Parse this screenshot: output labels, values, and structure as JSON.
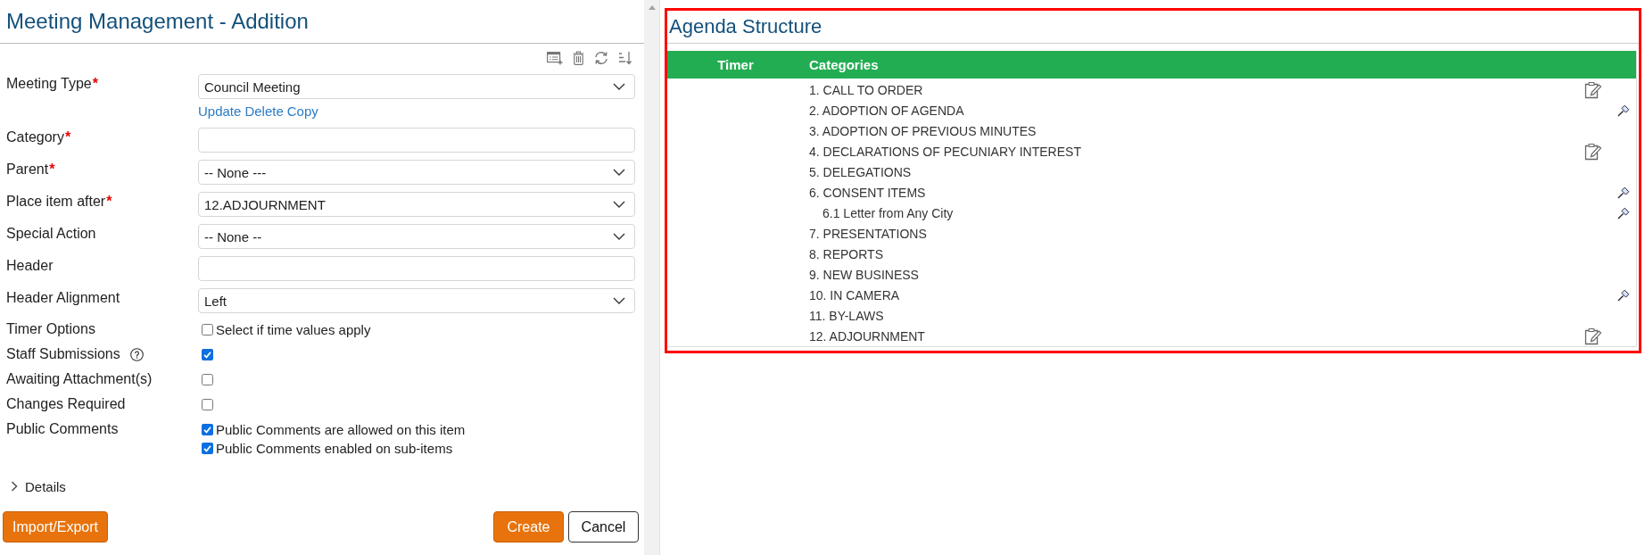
{
  "form": {
    "title": "Meeting Management - Addition",
    "fields": [
      {
        "kind": "select",
        "label": "Meeting Type",
        "required_mark": "*",
        "value": "Council Meeting",
        "links": [
          "Update",
          "Delete",
          "Copy"
        ]
      },
      {
        "kind": "text",
        "label": "Category",
        "required_mark": "*"
      },
      {
        "kind": "select",
        "label": "Parent",
        "required_mark": "*",
        "value": "-- None ---"
      },
      {
        "kind": "select",
        "label": "Place item after",
        "required_mark": "*",
        "value": "12.ADJOURNMENT"
      },
      {
        "kind": "select",
        "label": "Special Action",
        "value": "-- None --"
      },
      {
        "kind": "text",
        "label": "Header"
      },
      {
        "kind": "select",
        "label": "Header Alignment",
        "value": "Left"
      },
      {
        "kind": "checkbox",
        "label": "Timer Options",
        "options": [
          {
            "text": "Select if time values apply",
            "checked": false
          }
        ]
      },
      {
        "kind": "checkbox",
        "label": "Staff Submissions",
        "help": true,
        "options": [
          {
            "checked": true
          }
        ]
      },
      {
        "kind": "checkbox",
        "label": "Awaiting Attachment(s)",
        "options": [
          {
            "checked": false
          }
        ]
      },
      {
        "kind": "checkbox",
        "label": "Changes Required",
        "options": [
          {
            "checked": false
          }
        ]
      },
      {
        "kind": "checkbox",
        "label": "Public Comments",
        "options": [
          {
            "text": "Public Comments are allowed on this item",
            "checked": true
          },
          {
            "text": "Public Comments enabled on sub-items",
            "checked": true
          }
        ]
      }
    ],
    "details": {
      "label": "Details",
      "expanded": false
    },
    "buttons": {
      "left": [
        {
          "label": "Import/Export",
          "kind": "primary"
        }
      ],
      "right": [
        {
          "label": "Create",
          "kind": "primary"
        },
        {
          "label": "Cancel",
          "kind": "secondary"
        }
      ]
    }
  },
  "agenda": {
    "title": "Agenda Structure",
    "highlighted": true,
    "columns": [
      "Timer",
      "Categories"
    ],
    "items": [
      {
        "text": "1. CALL TO ORDER",
        "kind": "clipboard"
      },
      {
        "text": "2. ADOPTION OF AGENDA",
        "kind": "gavel"
      },
      {
        "text": "3. ADOPTION OF PREVIOUS MINUTES",
        "kind": "plain"
      },
      {
        "text": "4. DECLARATIONS OF PECUNIARY INTEREST",
        "kind": "clipboard"
      },
      {
        "text": "5. DELEGATIONS",
        "kind": "plain"
      },
      {
        "text": "6. CONSENT ITEMS",
        "kind": "gavel",
        "children": [
          {
            "text": "6.1 Letter from Any City",
            "kind": "gavel"
          }
        ]
      },
      {
        "text": "7. PRESENTATIONS",
        "kind": "plain"
      },
      {
        "text": "8. REPORTS",
        "kind": "plain"
      },
      {
        "text": "9. NEW BUSINESS",
        "kind": "plain"
      },
      {
        "text": "10. IN CAMERA",
        "kind": "gavel"
      },
      {
        "text": "11. BY-LAWS",
        "kind": "plain"
      },
      {
        "text": "12. ADJOURNMENT",
        "kind": "clipboard"
      }
    ]
  }
}
